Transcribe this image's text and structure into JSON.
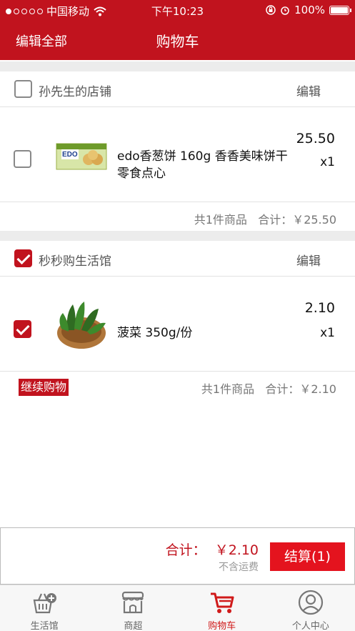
{
  "status_bar": {
    "carrier": "中国移动",
    "time": "下午10:23",
    "battery": "100%"
  },
  "nav": {
    "edit_all": "编辑全部",
    "title": "购物车"
  },
  "shops": [
    {
      "name": "孙先生的店铺",
      "edit": "编辑",
      "checked": false,
      "items": [
        {
          "name": "edo香葱饼 160g 香香美味饼干零食点心",
          "price": "25.50",
          "qty": "x1",
          "checked": false
        }
      ],
      "summary": "共1件商品   合计：￥25.50"
    },
    {
      "name": "秒秒购生活馆",
      "edit": "编辑",
      "checked": true,
      "items": [
        {
          "name": "菠菜 350g/份",
          "price": "2.10",
          "qty": "x1",
          "checked": true
        }
      ],
      "summary": "共1件商品   合计：￥2.10"
    }
  ],
  "continue_shopping": "继续购物",
  "checkout": {
    "total": "合计：  ￥2.10",
    "shipping_note": "不含运费",
    "button": "结算(1)"
  },
  "tabbar": {
    "tabs": [
      {
        "label": "生活馆",
        "icon": "basket-plus-icon",
        "active": false
      },
      {
        "label": "商超",
        "icon": "store-icon",
        "active": false
      },
      {
        "label": "购物车",
        "icon": "cart-icon",
        "active": true
      },
      {
        "label": "个人中心",
        "icon": "user-icon",
        "active": false
      }
    ]
  },
  "colors": {
    "brand": "#c1131e",
    "checkout_button": "#e4131e",
    "tab_active": "#d01a1a"
  }
}
